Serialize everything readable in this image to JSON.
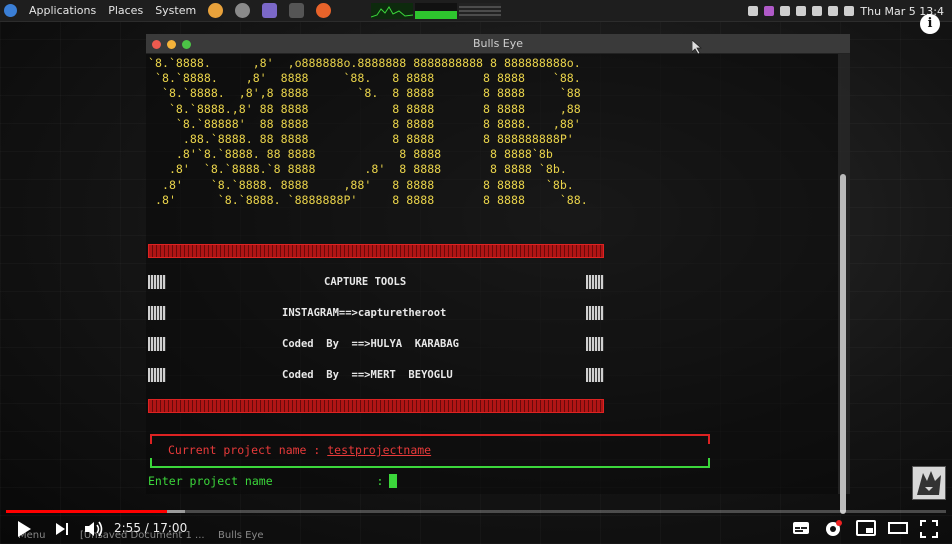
{
  "topbar": {
    "applications": "Applications",
    "places": "Places",
    "system": "System",
    "clock": "Thu Mar  5 13:4"
  },
  "window": {
    "title": "Bulls Eye",
    "dot_colors": [
      "#ee5a4f",
      "#f5b33a",
      "#4cc446"
    ]
  },
  "banner": [
    "`8.`8888.      ,8'  ,o888888o.8888888 8888888888 8 888888888o.",
    " `8.`8888.    ,8'  8888     `88.   8 8888       8 8888    `88.",
    "  `8.`8888.  ,8',8 8888       `8.  8 8888       8 8888     `88",
    "   `8.`8888.,8' 88 8888            8 8888       8 8888     ,88",
    "    `8.`88888'  88 8888            8 8888       8 8888.   ,88'",
    "     .88.`8888. 88 8888            8 8888       8 888888888P'",
    "    .8'`8.`8888. 88 8888            8 8888       8 8888`8b",
    "   .8'  `8.`8888.`8 8888       .8'  8 8888       8 8888 `8b.",
    "  .8'    `8.`8888. 8888     ,88'   8 8888       8 8888   `8b.",
    " .8'      `8.`8888. `8888888P'     8 8888       8 8888     `88."
  ],
  "tools": {
    "heading": "CAPTURE TOOLS",
    "instagram": "INSTAGRAM==>capturetheroot",
    "coded_by_1": "Coded  By  ==>HULYA  KARABAG",
    "coded_by_2": "Coded  By  ==>MERT  BEYOGLU"
  },
  "project": {
    "label": "Current project name : ",
    "value": "testprojectname",
    "prompt": "Enter project name               :"
  },
  "player": {
    "time": "2:55 / 17:00",
    "progress": 0.1716,
    "buffered": 0.19
  },
  "taskbar": {
    "menu": "Menu",
    "doc": "[Unsaved Document 1 ...",
    "task": "Bulls Eye"
  },
  "colors": {
    "banner": "#e8d24a",
    "accent_red": "#dd2222",
    "accent_green": "#3bd63b",
    "youtube_red": "#ff0000"
  },
  "icons": [
    "info-icon",
    "play-icon",
    "next-icon",
    "volume-icon",
    "subtitles-icon",
    "settings-icon",
    "miniplayer-icon",
    "theater-icon",
    "fullscreen-icon"
  ]
}
